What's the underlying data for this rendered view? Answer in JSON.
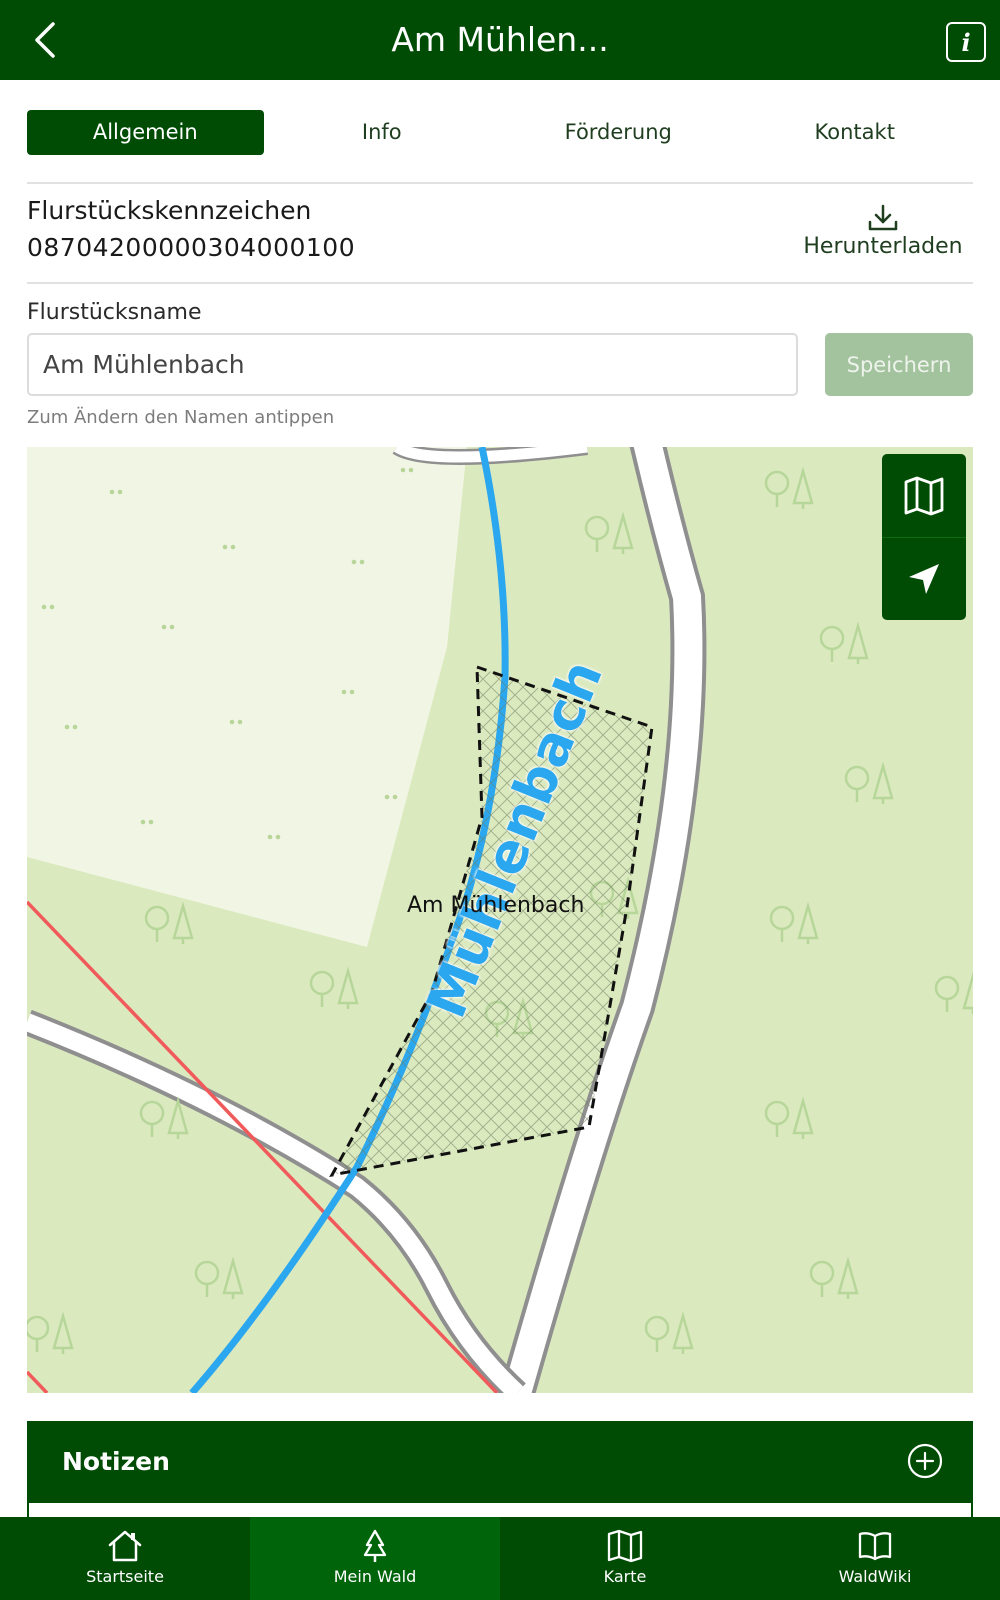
{
  "header": {
    "title": "Am Mühlen...",
    "info_icon_glyph": "i"
  },
  "tabs": [
    {
      "label": "Allgemein",
      "active": true
    },
    {
      "label": "Info",
      "active": false
    },
    {
      "label": "Förderung",
      "active": false
    },
    {
      "label": "Kontakt",
      "active": false
    }
  ],
  "parcel": {
    "id_label": "Flurstückskennzeichen",
    "id_value": "08704200000304000100",
    "download_label": "Herunterladen"
  },
  "name_field": {
    "label": "Flurstücksname",
    "value": "Am Mühlenbach",
    "save_label": "Speichern",
    "hint": "Zum Ändern den Namen antippen"
  },
  "map": {
    "river_label": "Mühlenbach",
    "parcel_label": "Am Mühlenbach",
    "controls": [
      "map-layers-icon",
      "locate-icon"
    ]
  },
  "notes": {
    "title": "Notizen"
  },
  "bottom_nav": [
    {
      "label": "Startseite",
      "icon": "home-icon",
      "active": false
    },
    {
      "label": "Mein Wald",
      "icon": "tree-icon",
      "active": true
    },
    {
      "label": "Karte",
      "icon": "map-icon",
      "active": false
    },
    {
      "label": "WaldWiki",
      "icon": "book-icon",
      "active": false
    }
  ],
  "colors": {
    "primary": "#004c05",
    "nav_active": "#00640a",
    "save_disabled": "#a3c29e",
    "map_forest": "#dbe9bf",
    "map_meadow": "#f1f6e4",
    "river": "#2aa7ef",
    "boundary_red": "#f05a5a"
  }
}
